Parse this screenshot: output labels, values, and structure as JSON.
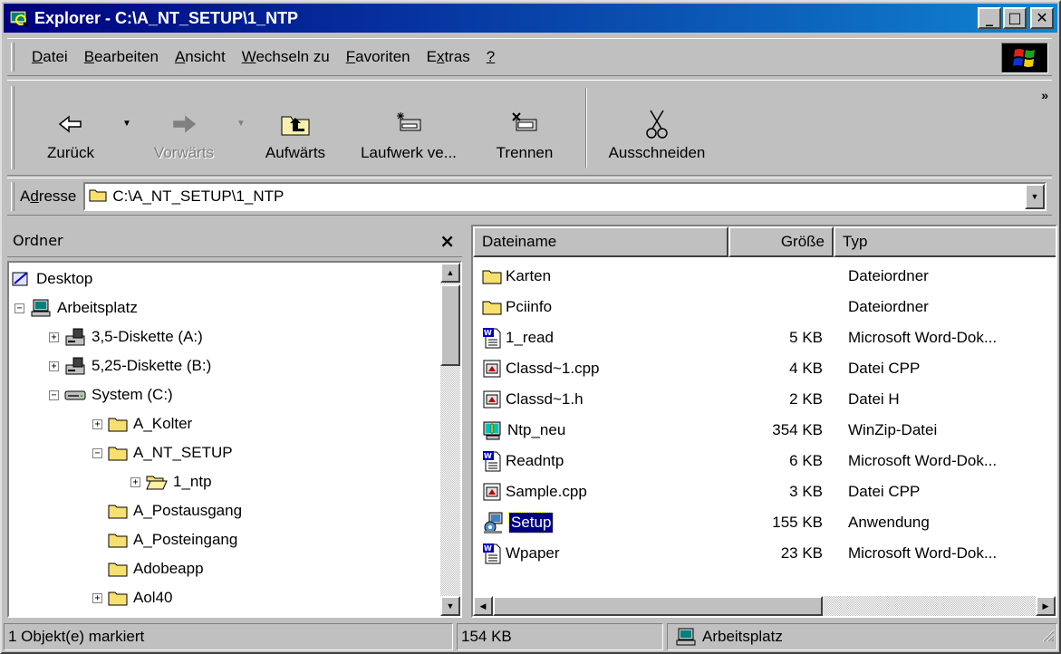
{
  "window": {
    "title": "Explorer - C:\\A_NT_SETUP\\1_NTP",
    "minimize": "_",
    "maximize": "□",
    "close": "✕"
  },
  "menu": [
    {
      "label": "Datei",
      "key": "D",
      "rest": "atei"
    },
    {
      "label": "Bearbeiten",
      "key": "B",
      "rest": "earbeiten"
    },
    {
      "label": "Ansicht",
      "key": "A",
      "rest": "nsicht"
    },
    {
      "label": "Wechseln zu",
      "key": "W",
      "rest": "echseln zu"
    },
    {
      "label": "Favoriten",
      "key": "F",
      "rest": "avoriten"
    },
    {
      "label": "Extras",
      "pre": "E",
      "key": "x",
      "rest": "tras"
    },
    {
      "label": "?",
      "key": "?",
      "rest": ""
    }
  ],
  "toolbar": {
    "back": "Zurück",
    "forward": "Vorwärts",
    "up": "Aufwärts",
    "map_drive": "Laufwerk ve...",
    "disconnect": "Trennen",
    "cut": "Ausschneiden",
    "more": "»"
  },
  "address": {
    "label_pre": "A",
    "label_key": "d",
    "label_rest": "resse",
    "value": "C:\\A_NT_SETUP\\1_NTP"
  },
  "folders": {
    "header": "Ordner",
    "close": "×",
    "items": [
      {
        "label": "Desktop",
        "icon": "desktop-icon",
        "level": 0,
        "exp": ""
      },
      {
        "label": "Arbeitsplatz",
        "icon": "computer-icon",
        "level": 1,
        "exp": "−"
      },
      {
        "label": "3,5-Diskette (A:)",
        "icon": "floppy-drive-icon",
        "level": 2,
        "exp": "+"
      },
      {
        "label": "5,25-Diskette (B:)",
        "icon": "floppy-drive-icon",
        "level": 2,
        "exp": "+"
      },
      {
        "label": "System (C:)",
        "icon": "hard-drive-icon",
        "level": 2,
        "exp": "−"
      },
      {
        "label": "A_Kolter",
        "icon": "folder-icon",
        "level": 3,
        "exp": "+"
      },
      {
        "label": "A_NT_SETUP",
        "icon": "folder-icon",
        "level": 3,
        "exp": "−"
      },
      {
        "label": "1_ntp",
        "icon": "open-folder-icon",
        "level": 4,
        "exp": "+"
      },
      {
        "label": "A_Postausgang",
        "icon": "folder-icon",
        "level": 3,
        "exp": ""
      },
      {
        "label": "A_Posteingang",
        "icon": "folder-icon",
        "level": 3,
        "exp": ""
      },
      {
        "label": "Adobeapp",
        "icon": "folder-icon",
        "level": 3,
        "exp": ""
      },
      {
        "label": "Aol40",
        "icon": "folder-icon",
        "level": 3,
        "exp": "+"
      }
    ]
  },
  "files": {
    "columns": {
      "name": "Dateiname",
      "size": "Größe",
      "type": "Typ"
    },
    "rows": [
      {
        "name": "Karten",
        "size": "",
        "type": "Dateiordner",
        "icon": "folder-icon"
      },
      {
        "name": "Pciinfo",
        "size": "",
        "type": "Dateiordner",
        "icon": "folder-icon"
      },
      {
        "name": "1_read",
        "size": "5 KB",
        "type": "Microsoft Word-Dok...",
        "icon": "word-doc-icon"
      },
      {
        "name": "Classd~1.cpp",
        "size": "4 KB",
        "type": "Datei CPP",
        "icon": "cpp-file-icon"
      },
      {
        "name": "Classd~1.h",
        "size": "2 KB",
        "type": "Datei H",
        "icon": "header-file-icon"
      },
      {
        "name": "Ntp_neu",
        "size": "354 KB",
        "type": "WinZip-Datei",
        "icon": "winzip-icon"
      },
      {
        "name": "Readntp",
        "size": "6 KB",
        "type": "Microsoft Word-Dok...",
        "icon": "word-doc-icon"
      },
      {
        "name": "Sample.cpp",
        "size": "3 KB",
        "type": "Datei CPP",
        "icon": "cpp-file-icon"
      },
      {
        "name": "Setup",
        "size": "155 KB",
        "type": "Anwendung",
        "icon": "setup-app-icon",
        "selected": true
      },
      {
        "name": "Wpaper",
        "size": "23 KB",
        "type": "Microsoft Word-Dok...",
        "icon": "word-doc-icon"
      }
    ]
  },
  "status": {
    "selection": "1 Objekt(e) markiert",
    "size": "154 KB",
    "zone": "Arbeitsplatz"
  }
}
